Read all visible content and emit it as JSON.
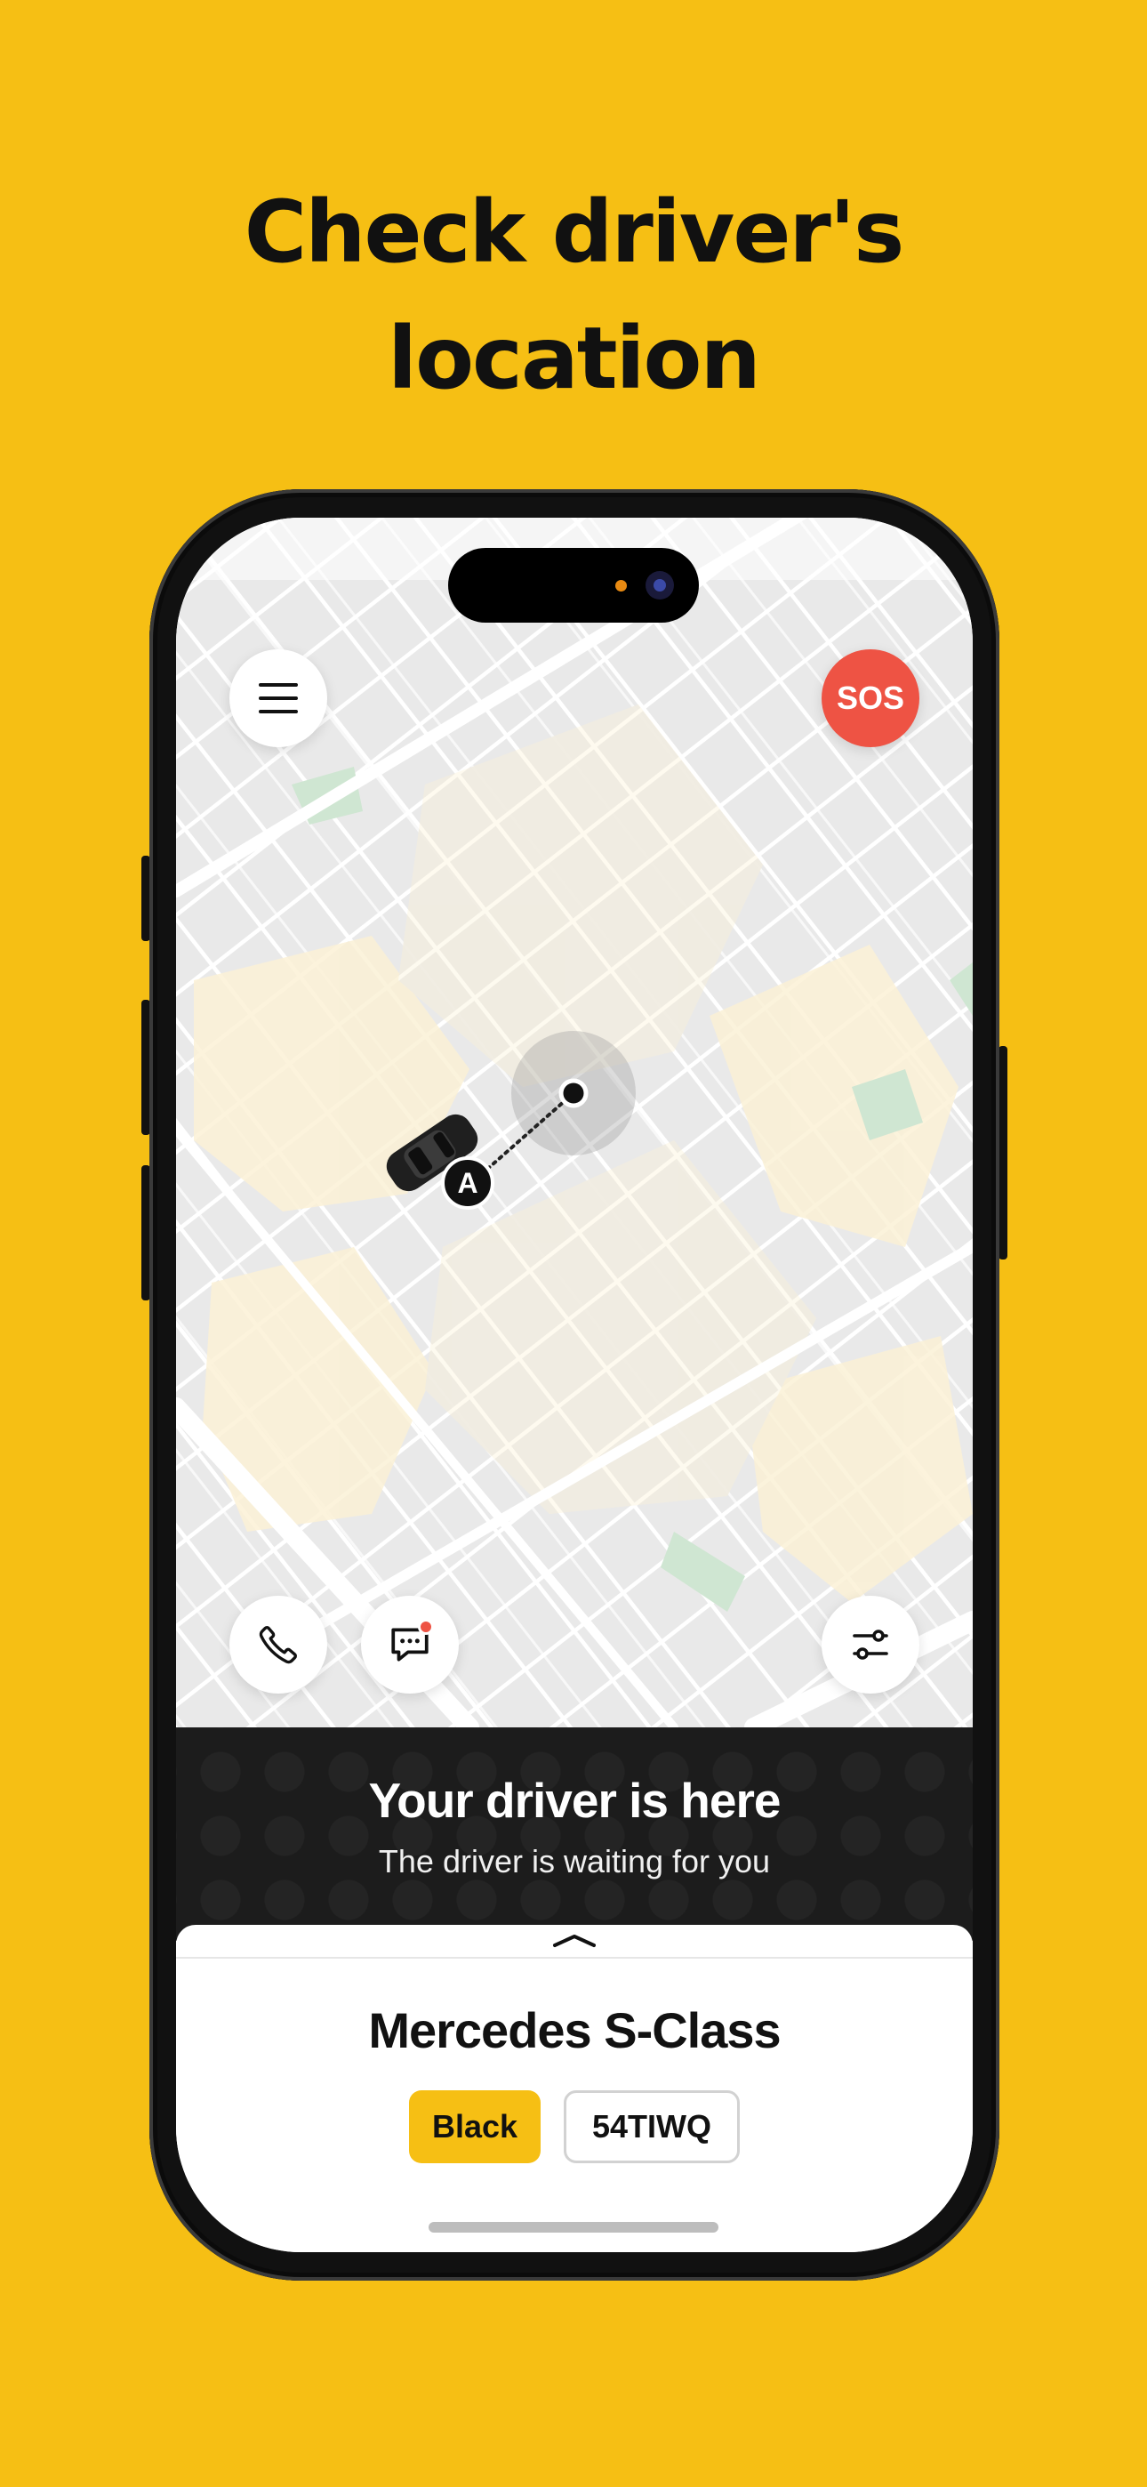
{
  "headline": {
    "line1": "Check driver's",
    "line2": "location"
  },
  "map": {
    "menu_button": "menu-icon",
    "sos_label": "SOS",
    "pickup_marker_label": "A",
    "actions": {
      "call": "phone-icon",
      "chat": "chat-icon",
      "route": "route-icon"
    }
  },
  "status": {
    "title": "Your driver is here",
    "subtitle": "The driver is waiting for you"
  },
  "vehicle": {
    "model": "Mercedes S-Class",
    "color": "Black",
    "plate": "54TIWQ"
  },
  "colors": {
    "background": "#F6BF14",
    "sos": "#EE5344",
    "banner": "#1c1c1c",
    "chip": "#F6BF14"
  }
}
